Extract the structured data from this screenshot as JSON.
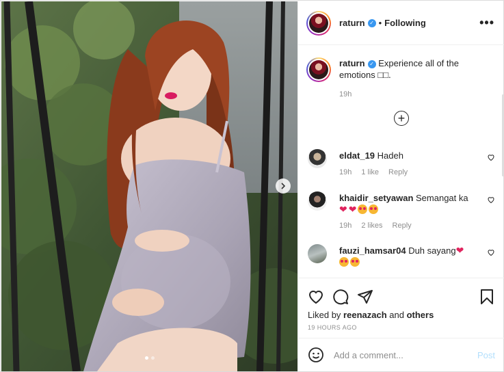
{
  "post": {
    "username": "raturn",
    "separator": "•",
    "follow_status": "Following",
    "more_label": "•••",
    "caption": "Experience all of the emotions",
    "caption_suffix": "□□.",
    "caption_time": "19h"
  },
  "comments": [
    {
      "username": "eldat_19",
      "text": "Hadeh",
      "time": "19h",
      "likes": "1 like",
      "reply": "Reply",
      "emojis": []
    },
    {
      "username": "khaidir_setyawan",
      "text": "Semangat ka",
      "time": "19h",
      "likes": "2 likes",
      "reply": "Reply",
      "emojis": [
        "heart",
        "heart",
        "heart-eyes",
        "heart-eyes"
      ]
    },
    {
      "username": "fauzi_hamsar04",
      "text": "Duh sayang",
      "emojis": [
        "heart",
        "heart-eyes",
        "heart-eyes"
      ]
    }
  ],
  "actions": {
    "icons": [
      "heart-icon",
      "comment-icon",
      "share-icon",
      "bookmark-icon"
    ]
  },
  "likes": {
    "prefix": "Liked by",
    "user": "reenazach",
    "joiner": "and",
    "others": "others"
  },
  "timestamp": "19 HOURS AGO",
  "add_comment": {
    "placeholder": "Add a comment...",
    "post_label": "Post"
  },
  "carousel": {
    "count": 2,
    "active": 1
  },
  "colors": {
    "verified": "#3897f0",
    "post_button": "#b2dffc",
    "muted": "#8e8e8e"
  }
}
